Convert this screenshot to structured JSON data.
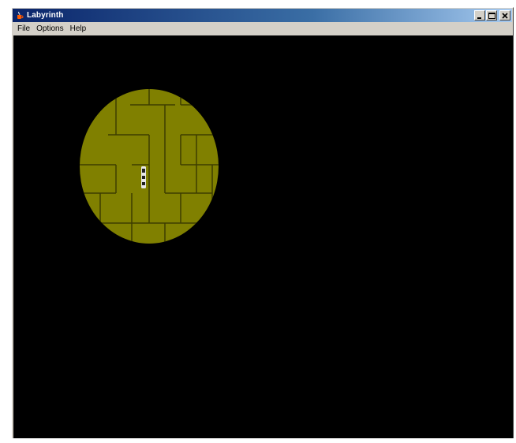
{
  "window": {
    "title": "Labyrinth",
    "icon": "java-cup-icon",
    "controls": [
      "minimize",
      "maximize",
      "close"
    ]
  },
  "menu": {
    "file_label": "File",
    "options_label": "Options",
    "help_label": "Help"
  },
  "game": {
    "background_color": "#000000",
    "light_color": "#808000",
    "wall_color": "#3d3d00",
    "player_color": "#e8e8e8"
  }
}
